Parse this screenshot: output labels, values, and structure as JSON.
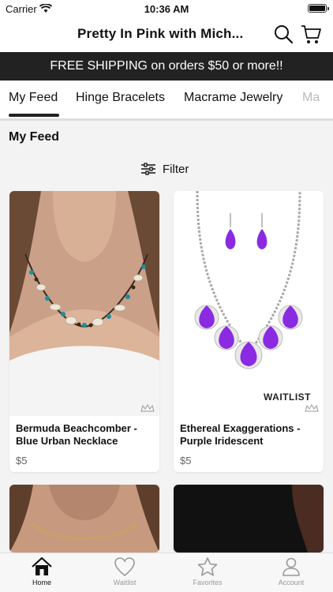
{
  "status_bar": {
    "carrier": "Carrier",
    "time": "10:36 AM"
  },
  "header": {
    "title": "Pretty In Pink with Mich..."
  },
  "promo": {
    "text": "FREE SHIPPING on orders $50 or more!!"
  },
  "tabs": [
    {
      "label": "My Feed",
      "active": true
    },
    {
      "label": "Hinge Bracelets"
    },
    {
      "label": "Macrame Jewelry"
    },
    {
      "label": "Ma"
    }
  ],
  "feed": {
    "title": "My Feed",
    "filter_label": "Filter",
    "products": [
      {
        "name": "Bermuda Beachcomber - Blue Urban Necklace",
        "price": "$5"
      },
      {
        "name": "Ethereal Exaggerations - Purple Iridescent",
        "price": "$5",
        "badge": "WAITLIST"
      }
    ]
  },
  "tab_bar": [
    {
      "label": "Home",
      "icon": "home-icon",
      "active": true
    },
    {
      "label": "Waitlist",
      "icon": "heart-icon"
    },
    {
      "label": "Favorites",
      "icon": "star-icon"
    },
    {
      "label": "Account",
      "icon": "person-icon"
    }
  ],
  "colors": {
    "banner_bg": "#222222",
    "accent_purple": "#8a2be2",
    "text": "#111111",
    "muted": "#999999"
  }
}
